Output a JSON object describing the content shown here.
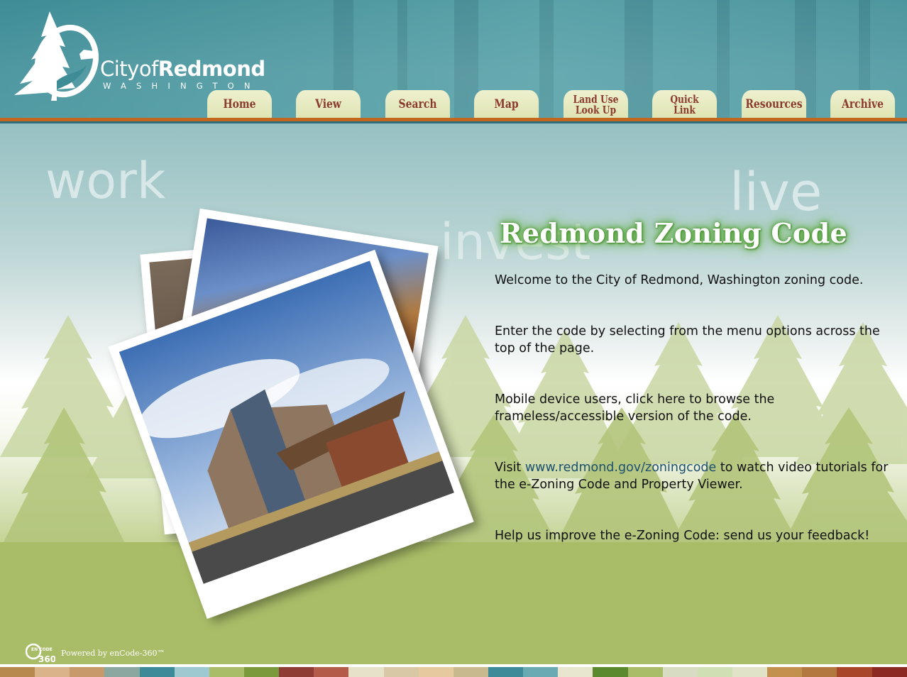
{
  "header": {
    "logo": {
      "city_prefix": "Cityof",
      "city_name": "Redmond",
      "state": "WASHINGTON"
    },
    "nav": [
      {
        "lines": [
          "Home"
        ]
      },
      {
        "lines": [
          "View"
        ]
      },
      {
        "lines": [
          "Search"
        ]
      },
      {
        "lines": [
          "Map"
        ]
      },
      {
        "lines": [
          "Land Use",
          "Look Up"
        ]
      },
      {
        "lines": [
          "Quick",
          "Link"
        ]
      },
      {
        "lines": [
          "Resources"
        ]
      },
      {
        "lines": [
          "Archive"
        ]
      }
    ]
  },
  "background_words": [
    "work",
    "invest",
    "live"
  ],
  "main": {
    "title": "Redmond Zoning Code",
    "welcome": "Welcome to the City of Redmond, Washington zoning code.",
    "enter": "Enter the code by selecting from the menu options across the top of the page.",
    "mobile": "Mobile device users, click here to browse the frameless/accessible version of the code.",
    "visit_prefix": "Visit ",
    "visit_link": "www.redmond.gov/zoningcode",
    "visit_suffix": " to watch video tutorials for the e-Zoning Code and Property Viewer.",
    "feedback": "Help us improve the e-Zoning Code: send us your feedback!"
  },
  "footer": {
    "badge_top": "EN CODE",
    "badge_num": "360",
    "powered_by": "Powered by enCode-360™"
  },
  "colors": {
    "header_teal": "#4f98a0",
    "accent_orange": "#c2671d",
    "nav_text": "#8a3a2c",
    "nav_tab": "#e6e9c0",
    "grass": "#a9bd68",
    "link": "#1d4f70"
  },
  "stripe_colors": [
    "#b8894e",
    "#d9b48a",
    "#c89a6a",
    "#8aa7a0",
    "#3d8a98",
    "#9ec9d0",
    "#a9bd68",
    "#7a9a3c",
    "#8e3c34",
    "#b45b4a",
    "#e6e2c8",
    "#d8c8a6",
    "#e7c9a0",
    "#c9b98e",
    "#3d8a98",
    "#6aaab2",
    "#e9e6cf",
    "#5b8a2e",
    "#a9bd68",
    "#d7dcc2",
    "#cfe0b4",
    "#e0e3c8",
    "#c4904e",
    "#b37840",
    "#a8462a",
    "#8a2a22"
  ]
}
